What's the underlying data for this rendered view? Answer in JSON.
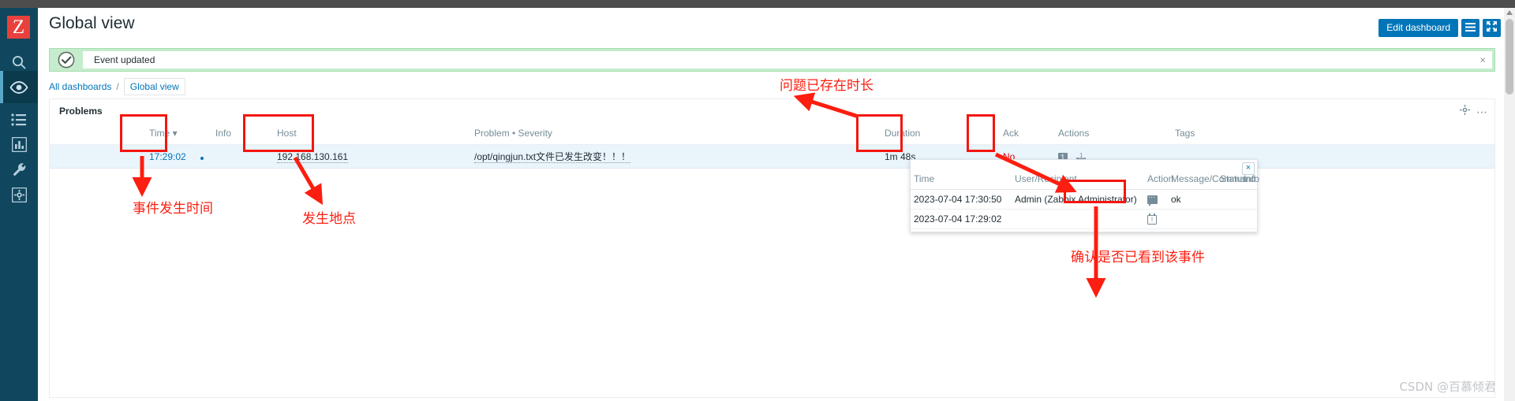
{
  "sidebar": {
    "logo": "Z",
    "items": [
      {
        "name": "search-icon",
        "label": "Search"
      },
      {
        "name": "monitoring-icon",
        "label": "Monitoring",
        "active": true
      },
      {
        "name": "list-icon",
        "label": "Services"
      },
      {
        "name": "reports-icon",
        "label": "Reports"
      },
      {
        "name": "administration-icon",
        "label": "Administration"
      },
      {
        "name": "settings-icon",
        "label": "Settings"
      }
    ]
  },
  "header": {
    "title": "Global view",
    "edit_dashboard_label": "Edit dashboard",
    "kebab_icon": "hamburger-icon",
    "expand_icon": "fullscreen-icon"
  },
  "message_bar": {
    "icon": "success-check-icon",
    "text": "Event updated",
    "close_label": "×"
  },
  "breadcrumb": {
    "root": "All dashboards",
    "separator": "/",
    "current": "Global view"
  },
  "widget": {
    "title": "Problems",
    "gear_icon": "gear-icon",
    "kebab_icon": "ellipsis-icon",
    "columns": [
      "",
      "Time",
      "",
      "Info",
      "Host",
      "Problem • Severity",
      "Duration",
      "Ack",
      "Actions",
      "Tags"
    ],
    "sort_indicator": "▾",
    "rows": [
      {
        "time": "17:29:02",
        "info": "",
        "host": "192.168.130.161",
        "problem": "/opt/qingjun.txt文件已发生改变！！！",
        "duration": "1m 48s",
        "ack": "No",
        "actions_count": "1",
        "actions_secondary": "1",
        "tags": ""
      }
    ]
  },
  "popup": {
    "close_label": "×",
    "columns": [
      "Time",
      "User/Recipient",
      "Action",
      "Message/Command",
      "Status",
      "Info"
    ],
    "rows": [
      {
        "time": "2023-07-04 17:30:50",
        "user": "Admin (Zabbix Administrator)",
        "action_icon": "message-icon",
        "message": "ok",
        "status": "",
        "info": ""
      },
      {
        "time": "2023-07-04 17:29:02",
        "user": "",
        "action_icon": "event-icon",
        "message": "",
        "status": "",
        "info": ""
      }
    ]
  },
  "annotations": {
    "color": "#fc1e10",
    "labels": [
      {
        "id": "duration-note",
        "text": "问题已存在时长"
      },
      {
        "id": "time-note",
        "text": "事件发生时间"
      },
      {
        "id": "host-note",
        "text": "发生地点"
      },
      {
        "id": "ack-note",
        "text": "确认是否已看到该事件"
      }
    ]
  },
  "watermark": {
    "text": "CSDN @百慕倾君"
  }
}
